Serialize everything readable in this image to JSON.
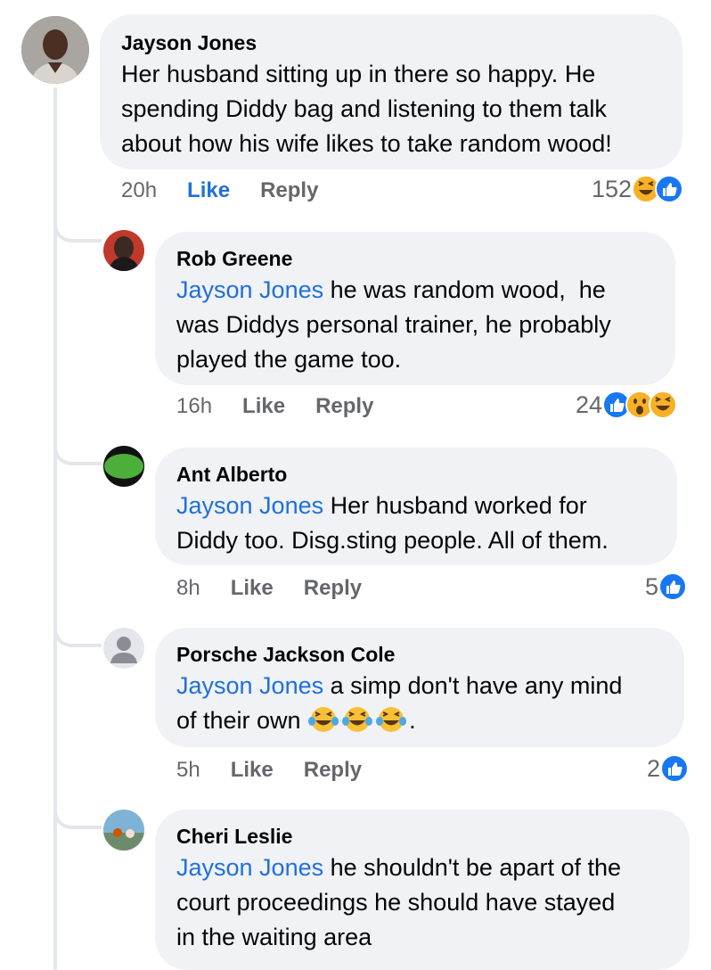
{
  "comments": [
    {
      "author": "Jayson Jones",
      "mention": "",
      "text_lines": [
        "Her husband sitting up in there so happy. He",
        "spending Diddy bag and listening to them talk",
        "about how his wife likes to take random wood!"
      ],
      "time": "20h",
      "like_label": "Like",
      "reply_label": "Reply",
      "reaction_count": "152",
      "reactions": [
        "haha-icon",
        "like-icon"
      ]
    },
    {
      "author": "Rob Greene",
      "mention": "Jayson Jones",
      "text_first": " he was random wood,  he",
      "text_lines": [
        "was Diddys personal trainer, he probably",
        "played the game too."
      ],
      "time": "16h",
      "like_label": "Like",
      "reply_label": "Reply",
      "reaction_count": "24",
      "reactions": [
        "like-icon",
        "wow-icon",
        "haha-icon"
      ]
    },
    {
      "author": "Ant Alberto",
      "mention": "Jayson Jones",
      "text_first": " Her husband worked for",
      "text_lines": [
        "Diddy too. Disg.sting people. All of them."
      ],
      "time": "8h",
      "like_label": "Like",
      "reply_label": "Reply",
      "reaction_count": "5",
      "reactions": [
        "like-icon"
      ]
    },
    {
      "author": "Porsche Jackson Cole",
      "mention": "Jayson Jones",
      "text_first": " a simp don't have any mind",
      "text_second": "of their own ",
      "text_end": ".",
      "time": "5h",
      "like_label": "Like",
      "reply_label": "Reply",
      "reaction_count": "2",
      "reactions": [
        "like-icon"
      ]
    },
    {
      "author": "Cheri Leslie",
      "mention": "Jayson Jones",
      "text_first": " he shouldn't be apart of the",
      "text_lines": [
        "court proceedings he should have stayed",
        "in the waiting area"
      ]
    }
  ],
  "colors": {
    "bubble": "#f0f2f5",
    "link_blue": "#216fdb",
    "meta_gray": "#65676b",
    "like_blue": "#1877f2"
  }
}
